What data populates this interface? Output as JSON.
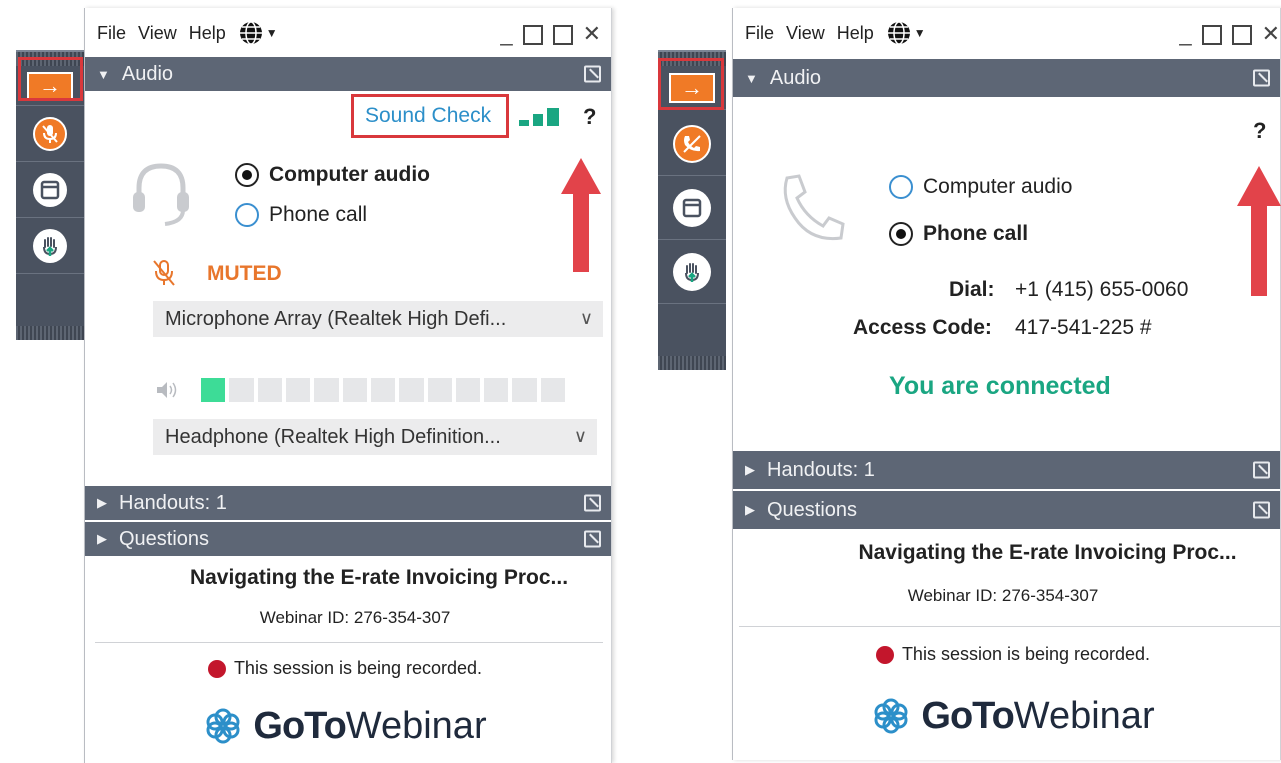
{
  "menu": {
    "file": "File",
    "view": "View",
    "help": "Help"
  },
  "left": {
    "audio_header": "Audio",
    "sound_check": "Sound Check",
    "help_mark": "?",
    "computer_audio": "Computer audio",
    "phone_call": "Phone call",
    "muted_label": "MUTED",
    "mic_device": "Microphone Array (Realtek High Defi...",
    "speaker_device": "Headphone (Realtek High Definition...",
    "handouts": "Handouts: 1",
    "questions": "Questions",
    "webinar_title": "Navigating the E-rate Invoicing Proc...",
    "webinar_id": "Webinar ID: 276-354-307",
    "recording": "This session is being recorded.",
    "mic_level": 0.08,
    "selected_audio": "computer"
  },
  "right": {
    "audio_header": "Audio",
    "help_mark": "?",
    "computer_audio": "Computer audio",
    "phone_call": "Phone call",
    "dial_label": "Dial:",
    "dial_number": "+1 (415) 655-0060",
    "access_label": "Access Code:",
    "access_code": "417-541-225 #",
    "connected": "You are connected",
    "handouts": "Handouts: 1",
    "questions": "Questions",
    "webinar_title": "Navigating the E-rate Invoicing Proc...",
    "webinar_id": "Webinar ID: 276-354-307",
    "recording": "This session is being recorded.",
    "selected_audio": "phone"
  },
  "logo": {
    "goto": "GoTo",
    "webinar": "Webinar"
  },
  "colors": {
    "toolbar": "#4a5260",
    "section_bar": "#5d6675",
    "accent_orange": "#f07a26",
    "muted_orange": "#e8762c",
    "connected_green": "#1aa682",
    "link_blue": "#2c8fc9",
    "highlight_red": "#d9383c",
    "recording_red": "#c3162c"
  },
  "icons": [
    "arrow-right-icon",
    "mic-muted-icon",
    "phone-hangup-icon",
    "window-icon",
    "raise-hand-icon",
    "headset-icon",
    "phone-handset-icon",
    "globe-icon",
    "speaker-icon",
    "help-icon",
    "goto-flower-icon"
  ]
}
